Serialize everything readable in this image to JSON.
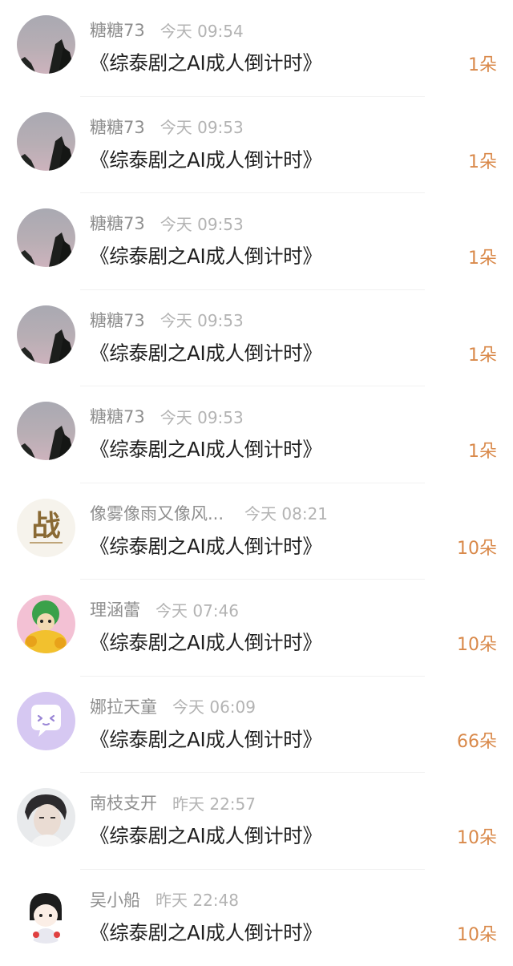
{
  "colors": {
    "name": "#8f8f8f",
    "time": "#b3b3b3",
    "title": "#1f1f1f",
    "count": "#d9894a",
    "divider": "#f1f1f1"
  },
  "gifts": [
    {
      "name": "糖糖73",
      "time": "今天 09:54",
      "title": "《综泰剧之AI成人倒计时》",
      "count": "1朵",
      "avatar": "sky-trees-avatar"
    },
    {
      "name": "糖糖73",
      "time": "今天 09:53",
      "title": "《综泰剧之AI成人倒计时》",
      "count": "1朵",
      "avatar": "sky-trees-avatar"
    },
    {
      "name": "糖糖73",
      "time": "今天 09:53",
      "title": "《综泰剧之AI成人倒计时》",
      "count": "1朵",
      "avatar": "sky-trees-avatar"
    },
    {
      "name": "糖糖73",
      "time": "今天 09:53",
      "title": "《综泰剧之AI成人倒计时》",
      "count": "1朵",
      "avatar": "sky-trees-avatar"
    },
    {
      "name": "糖糖73",
      "time": "今天 09:53",
      "title": "《综泰剧之AI成人倒计时》",
      "count": "1朵",
      "avatar": "sky-trees-avatar"
    },
    {
      "name": "像雾像雨又像风...",
      "time": "今天 08:21",
      "title": "《综泰剧之AI成人倒计时》",
      "count": "10朵",
      "avatar": "calligraphy-avatar",
      "avatar_text": "战"
    },
    {
      "name": "理涵蕾",
      "time": "今天 07:46",
      "title": "《综泰剧之AI成人倒计时》",
      "count": "10朵",
      "avatar": "cartoon-character-avatar"
    },
    {
      "name": "娜拉天童",
      "time": "今天 06:09",
      "title": "《综泰剧之AI成人倒计时》",
      "count": "66朵",
      "avatar": "chat-bubble-avatar"
    },
    {
      "name": "南枝支开",
      "time": "昨天 22:57",
      "title": "《综泰剧之AI成人倒计时》",
      "count": "10朵",
      "avatar": "portrait-avatar"
    },
    {
      "name": "吴小船",
      "time": "昨天 22:48",
      "title": "《综泰剧之AI成人倒计时》",
      "count": "10朵",
      "avatar": "chibi-character-avatar"
    }
  ]
}
